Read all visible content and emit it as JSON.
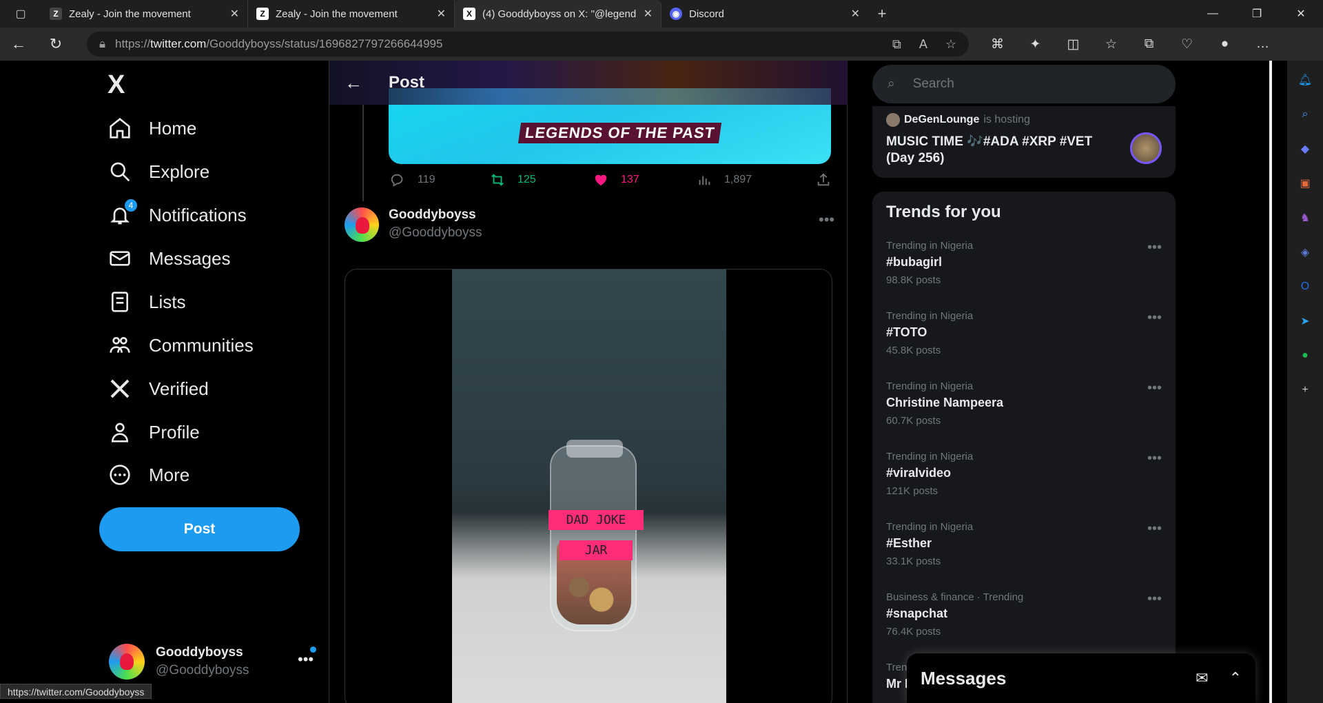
{
  "browser": {
    "tabs": [
      {
        "title": "Zealy - Join the movement"
      },
      {
        "title": "Zealy - Join the movement"
      },
      {
        "title": "(4) Gooddyboyss on X: \"@legend"
      },
      {
        "title": "Discord"
      }
    ],
    "url_prefix": "https://",
    "url_host": "twitter.com",
    "url_path": "/Gooddyboyss/status/1696827797266644995",
    "status_url": "https://twitter.com/Gooddyboyss"
  },
  "nav": {
    "logo": "X",
    "items": [
      {
        "label": "Home"
      },
      {
        "label": "Explore"
      },
      {
        "label": "Notifications"
      },
      {
        "label": "Messages"
      },
      {
        "label": "Lists"
      },
      {
        "label": "Communities"
      },
      {
        "label": "Verified"
      },
      {
        "label": "Profile"
      },
      {
        "label": "More"
      }
    ],
    "notif_badge": "4",
    "post_label": "Post",
    "account": {
      "name": "Gooddyboyss",
      "handle": "@Gooddyboyss"
    }
  },
  "main": {
    "title": "Post",
    "banner_text": "LEGENDS OF THE PAST",
    "stats": {
      "replies": "119",
      "reposts": "125",
      "likes": "137",
      "views": "1,897"
    },
    "reply": {
      "name": "Gooddyboyss",
      "handle": "@Gooddyboyss"
    },
    "video_labels": [
      "DAD JOKE",
      "JAR"
    ]
  },
  "sidebar": {
    "search_placeholder": "Search",
    "space": {
      "host": "DeGenLounge",
      "host_suffix": "is hosting",
      "title": "MUSIC TIME 🎶#ADA #XRP #VET (Day 256)"
    },
    "trends_title": "Trends for you",
    "trends": [
      {
        "context": "Trending in Nigeria",
        "name": "#bubagirl",
        "count": "98.8K posts"
      },
      {
        "context": "Trending in Nigeria",
        "name": "#TOTO",
        "count": "45.8K posts"
      },
      {
        "context": "Trending in Nigeria",
        "name": "Christine Nampeera",
        "count": "60.7K posts"
      },
      {
        "context": "Trending in Nigeria",
        "name": "#viralvideo",
        "count": "121K posts"
      },
      {
        "context": "Trending in Nigeria",
        "name": "#Esther",
        "count": "33.1K posts"
      },
      {
        "context": "Business & finance · Trending",
        "name": "#snapchat",
        "count": "76.4K posts"
      },
      {
        "context": "Tren",
        "name": "Mr I",
        "count": ""
      }
    ],
    "messages_dock": "Messages"
  },
  "colors": {
    "accent": "#1d9bf0",
    "like": "#f91880",
    "repost": "#00ba7c"
  }
}
